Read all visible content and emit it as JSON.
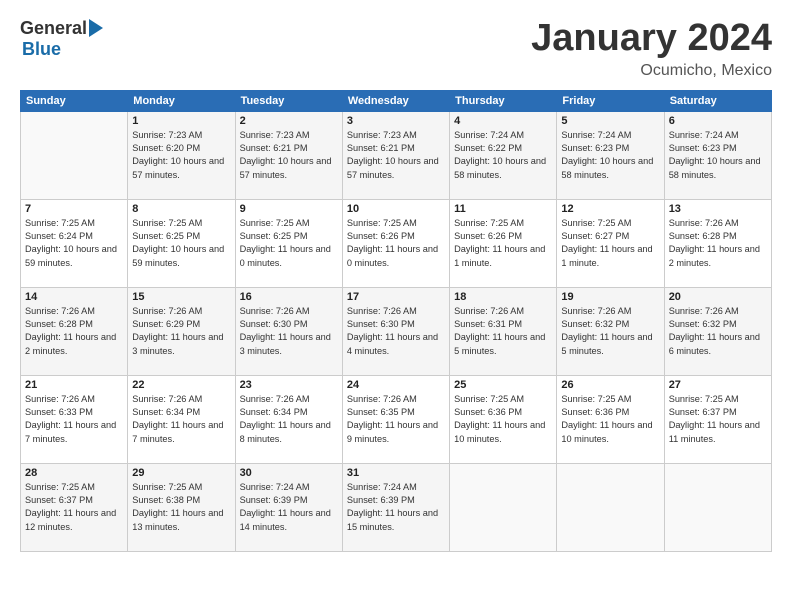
{
  "logo": {
    "general": "General",
    "blue": "Blue"
  },
  "title": "January 2024",
  "subtitle": "Ocumicho, Mexico",
  "days_header": [
    "Sunday",
    "Monday",
    "Tuesday",
    "Wednesday",
    "Thursday",
    "Friday",
    "Saturday"
  ],
  "weeks": [
    [
      {
        "day": "",
        "sunrise": "",
        "sunset": "",
        "daylight": ""
      },
      {
        "day": "1",
        "sunrise": "Sunrise: 7:23 AM",
        "sunset": "Sunset: 6:20 PM",
        "daylight": "Daylight: 10 hours and 57 minutes."
      },
      {
        "day": "2",
        "sunrise": "Sunrise: 7:23 AM",
        "sunset": "Sunset: 6:21 PM",
        "daylight": "Daylight: 10 hours and 57 minutes."
      },
      {
        "day": "3",
        "sunrise": "Sunrise: 7:23 AM",
        "sunset": "Sunset: 6:21 PM",
        "daylight": "Daylight: 10 hours and 57 minutes."
      },
      {
        "day": "4",
        "sunrise": "Sunrise: 7:24 AM",
        "sunset": "Sunset: 6:22 PM",
        "daylight": "Daylight: 10 hours and 58 minutes."
      },
      {
        "day": "5",
        "sunrise": "Sunrise: 7:24 AM",
        "sunset": "Sunset: 6:23 PM",
        "daylight": "Daylight: 10 hours and 58 minutes."
      },
      {
        "day": "6",
        "sunrise": "Sunrise: 7:24 AM",
        "sunset": "Sunset: 6:23 PM",
        "daylight": "Daylight: 10 hours and 58 minutes."
      }
    ],
    [
      {
        "day": "7",
        "sunrise": "Sunrise: 7:25 AM",
        "sunset": "Sunset: 6:24 PM",
        "daylight": "Daylight: 10 hours and 59 minutes."
      },
      {
        "day": "8",
        "sunrise": "Sunrise: 7:25 AM",
        "sunset": "Sunset: 6:25 PM",
        "daylight": "Daylight: 10 hours and 59 minutes."
      },
      {
        "day": "9",
        "sunrise": "Sunrise: 7:25 AM",
        "sunset": "Sunset: 6:25 PM",
        "daylight": "Daylight: 11 hours and 0 minutes."
      },
      {
        "day": "10",
        "sunrise": "Sunrise: 7:25 AM",
        "sunset": "Sunset: 6:26 PM",
        "daylight": "Daylight: 11 hours and 0 minutes."
      },
      {
        "day": "11",
        "sunrise": "Sunrise: 7:25 AM",
        "sunset": "Sunset: 6:26 PM",
        "daylight": "Daylight: 11 hours and 1 minute."
      },
      {
        "day": "12",
        "sunrise": "Sunrise: 7:25 AM",
        "sunset": "Sunset: 6:27 PM",
        "daylight": "Daylight: 11 hours and 1 minute."
      },
      {
        "day": "13",
        "sunrise": "Sunrise: 7:26 AM",
        "sunset": "Sunset: 6:28 PM",
        "daylight": "Daylight: 11 hours and 2 minutes."
      }
    ],
    [
      {
        "day": "14",
        "sunrise": "Sunrise: 7:26 AM",
        "sunset": "Sunset: 6:28 PM",
        "daylight": "Daylight: 11 hours and 2 minutes."
      },
      {
        "day": "15",
        "sunrise": "Sunrise: 7:26 AM",
        "sunset": "Sunset: 6:29 PM",
        "daylight": "Daylight: 11 hours and 3 minutes."
      },
      {
        "day": "16",
        "sunrise": "Sunrise: 7:26 AM",
        "sunset": "Sunset: 6:30 PM",
        "daylight": "Daylight: 11 hours and 3 minutes."
      },
      {
        "day": "17",
        "sunrise": "Sunrise: 7:26 AM",
        "sunset": "Sunset: 6:30 PM",
        "daylight": "Daylight: 11 hours and 4 minutes."
      },
      {
        "day": "18",
        "sunrise": "Sunrise: 7:26 AM",
        "sunset": "Sunset: 6:31 PM",
        "daylight": "Daylight: 11 hours and 5 minutes."
      },
      {
        "day": "19",
        "sunrise": "Sunrise: 7:26 AM",
        "sunset": "Sunset: 6:32 PM",
        "daylight": "Daylight: 11 hours and 5 minutes."
      },
      {
        "day": "20",
        "sunrise": "Sunrise: 7:26 AM",
        "sunset": "Sunset: 6:32 PM",
        "daylight": "Daylight: 11 hours and 6 minutes."
      }
    ],
    [
      {
        "day": "21",
        "sunrise": "Sunrise: 7:26 AM",
        "sunset": "Sunset: 6:33 PM",
        "daylight": "Daylight: 11 hours and 7 minutes."
      },
      {
        "day": "22",
        "sunrise": "Sunrise: 7:26 AM",
        "sunset": "Sunset: 6:34 PM",
        "daylight": "Daylight: 11 hours and 7 minutes."
      },
      {
        "day": "23",
        "sunrise": "Sunrise: 7:26 AM",
        "sunset": "Sunset: 6:34 PM",
        "daylight": "Daylight: 11 hours and 8 minutes."
      },
      {
        "day": "24",
        "sunrise": "Sunrise: 7:26 AM",
        "sunset": "Sunset: 6:35 PM",
        "daylight": "Daylight: 11 hours and 9 minutes."
      },
      {
        "day": "25",
        "sunrise": "Sunrise: 7:25 AM",
        "sunset": "Sunset: 6:36 PM",
        "daylight": "Daylight: 11 hours and 10 minutes."
      },
      {
        "day": "26",
        "sunrise": "Sunrise: 7:25 AM",
        "sunset": "Sunset: 6:36 PM",
        "daylight": "Daylight: 11 hours and 10 minutes."
      },
      {
        "day": "27",
        "sunrise": "Sunrise: 7:25 AM",
        "sunset": "Sunset: 6:37 PM",
        "daylight": "Daylight: 11 hours and 11 minutes."
      }
    ],
    [
      {
        "day": "28",
        "sunrise": "Sunrise: 7:25 AM",
        "sunset": "Sunset: 6:37 PM",
        "daylight": "Daylight: 11 hours and 12 minutes."
      },
      {
        "day": "29",
        "sunrise": "Sunrise: 7:25 AM",
        "sunset": "Sunset: 6:38 PM",
        "daylight": "Daylight: 11 hours and 13 minutes."
      },
      {
        "day": "30",
        "sunrise": "Sunrise: 7:24 AM",
        "sunset": "Sunset: 6:39 PM",
        "daylight": "Daylight: 11 hours and 14 minutes."
      },
      {
        "day": "31",
        "sunrise": "Sunrise: 7:24 AM",
        "sunset": "Sunset: 6:39 PM",
        "daylight": "Daylight: 11 hours and 15 minutes."
      },
      {
        "day": "",
        "sunrise": "",
        "sunset": "",
        "daylight": ""
      },
      {
        "day": "",
        "sunrise": "",
        "sunset": "",
        "daylight": ""
      },
      {
        "day": "",
        "sunrise": "",
        "sunset": "",
        "daylight": ""
      }
    ]
  ]
}
